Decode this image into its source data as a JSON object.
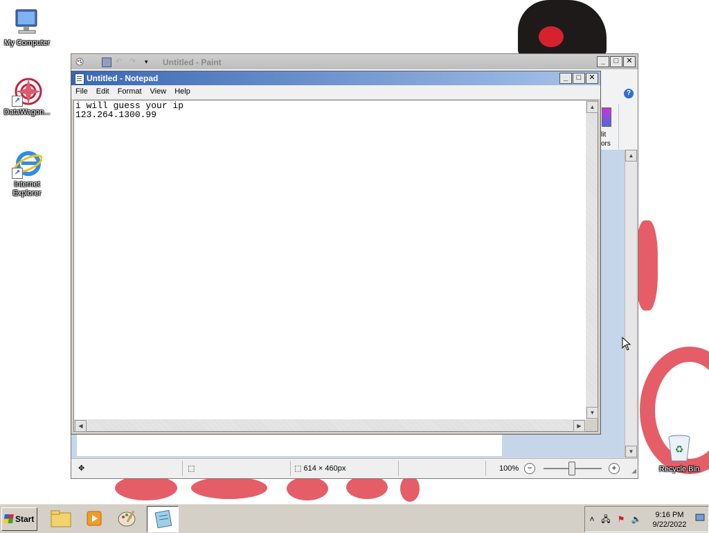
{
  "desktop": {
    "icons": [
      {
        "label": "My Computer"
      },
      {
        "label": "DataWagon..."
      },
      {
        "label": "Internet Explorer"
      }
    ],
    "recycle_bin": {
      "label": "Recycle Bin"
    }
  },
  "paint": {
    "title": "Untitled - Paint",
    "ribbon_partial_text": [
      "lit",
      "ors"
    ],
    "status": {
      "image_size": "614 × 460px",
      "zoom": "100%"
    }
  },
  "notepad": {
    "title": "Untitled - Notepad",
    "menu": [
      "File",
      "Edit",
      "Format",
      "View",
      "Help"
    ],
    "content": "i will guess your ip\n123.264.1300.99"
  },
  "taskbar": {
    "start_label": "Start",
    "time": "9:16 PM",
    "date": "9/22/2022"
  },
  "colors": {
    "notepad_title_start": "#3867b4",
    "notepad_title_end": "#a9c3ea",
    "wallpaper_red": "#e24d57",
    "taskbar": "#d4d0c8"
  }
}
